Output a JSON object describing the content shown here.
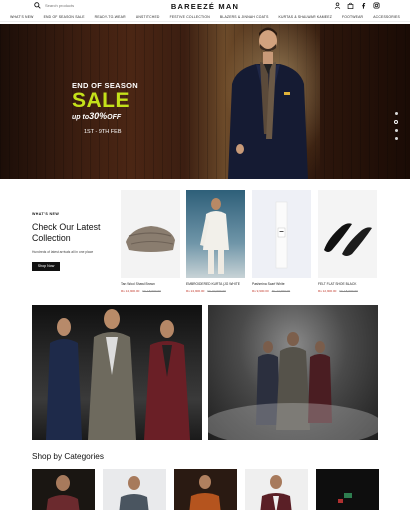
{
  "header": {
    "search_placeholder": "Search products",
    "brand": "BAREEZÉ MAN",
    "icons": [
      "user-icon",
      "bag-icon",
      "facebook-icon",
      "instagram-icon"
    ]
  },
  "nav": {
    "items": [
      "What's new",
      "End of season sale",
      "Ready-to-wear",
      "Unstitched",
      "Festive collection",
      "Blazers & Jinnah coats",
      "Kurtas & Shalwar Kameez",
      "Footwear",
      "Accessories"
    ]
  },
  "hero": {
    "kicker": "END OF SEASON",
    "sale": "SALE",
    "upto_prefix": "up to",
    "upto_value": "30%",
    "upto_suffix": "OFF",
    "dates": "1ST - 9TH FEB",
    "slides_total": 4,
    "active_slide": 2
  },
  "whats_new": {
    "kicker": "WHAT'S NEW",
    "title": "Check Our Latest Collection",
    "description": "Hundreds of latest arrivals all in one place",
    "button": "Shop Now",
    "products": [
      {
        "name": "Tan Wool Shawl Brown",
        "price": "Rs 14,900.00",
        "was": "Rs 18,900.00"
      },
      {
        "name": "EMBROIDERED KURTA (JG WHITE",
        "price": "Rs 24,900.00",
        "was": "Rs 32,900.00"
      },
      {
        "name": "Pashmina Scarf White",
        "price": "Rs 9,900.00",
        "was": "Rs 12,900.00"
      },
      {
        "name": "FELT FLAT SHOE BLACK",
        "price": "Rs 12,900.00",
        "was": "Rs 15,900.00"
      }
    ]
  },
  "categories": {
    "title": "Shop by Categories"
  },
  "colors": {
    "accent_lime": "#c4e11a",
    "sale_red": "#c0392b",
    "button_black": "#111111"
  }
}
